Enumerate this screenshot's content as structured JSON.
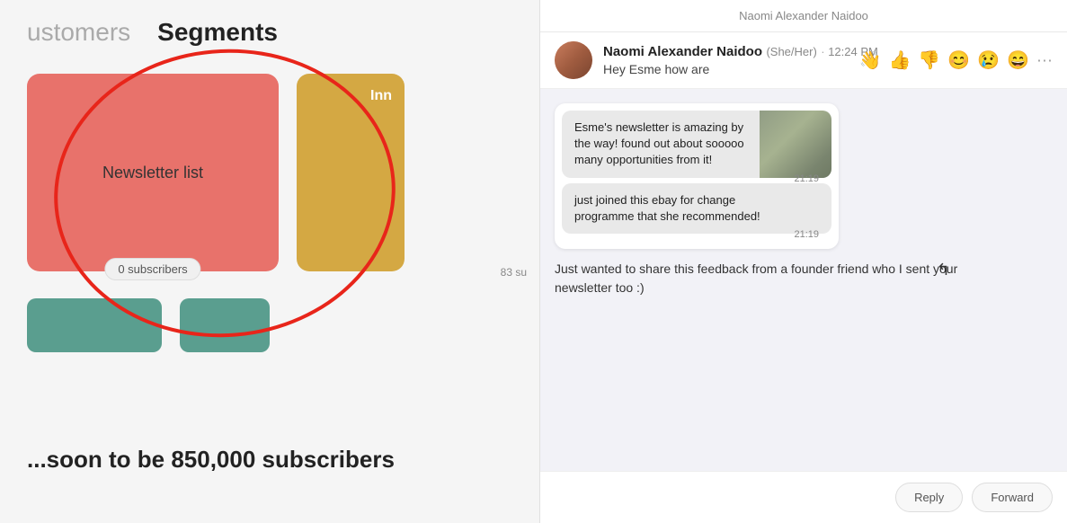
{
  "left": {
    "customers_label": "ustomers",
    "segments_label": "Segments",
    "newsletter_card": {
      "title": "Newsletter list",
      "subscribers": "0 subscribers"
    },
    "inn_card": {
      "label": "Inn",
      "subscribers": "83 su"
    },
    "soon_text": "...soon to be 850,000 subscribers"
  },
  "right": {
    "top_bar_label": "Naomi Alexander Naidoo",
    "contact": {
      "name": "Naomi Alexander Naidoo",
      "pronouns": "(She/Her)",
      "time": "12:24 PM"
    },
    "message_preview": "Hey Esme how are",
    "emojis": [
      "👋",
      "👍",
      "👎",
      "😊",
      "😢",
      "😄"
    ],
    "more_icon": "···",
    "whatsapp_msg1": {
      "text": "Esme's newsletter is amazing by the way! found out about sooooo many opportunities from it!",
      "time": "21:19"
    },
    "whatsapp_msg2": {
      "text": "just joined this ebay for change programme that she recommended!",
      "time": "21:19"
    },
    "body_text": "Just wanted to share this feedback from a founder friend who I sent your newsletter too :)",
    "footer_btn1": "Reply",
    "footer_btn2": "Forward"
  }
}
